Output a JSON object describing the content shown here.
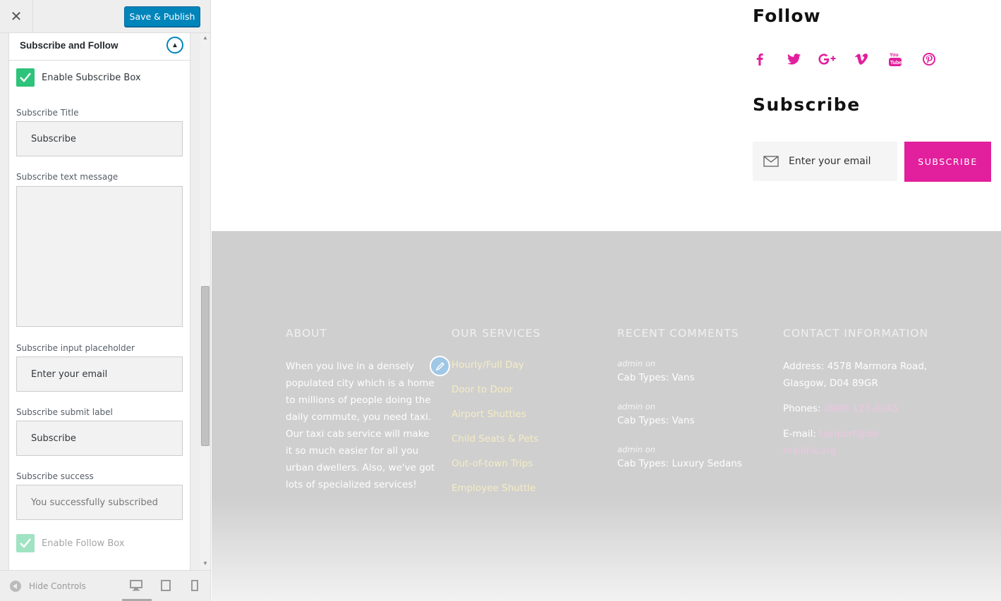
{
  "sidebar": {
    "close_label": "✕",
    "save_label": "Save & Publish",
    "section_title": "Subscribe and Follow",
    "enable_subscribe_label": "Enable Subscribe Box",
    "subscribe_title_label": "Subscribe Title",
    "subscribe_title_value": "Subscribe",
    "subscribe_text_label": "Subscribe text message",
    "subscribe_text_value": "",
    "placeholder_label": "Subscribe input placeholder",
    "placeholder_value": "Enter your email",
    "submit_label": "Subscribe submit label",
    "submit_value": "Subscribe",
    "success_label": "Subscribe success",
    "success_value": "You successfully subscribed",
    "enable_follow_label": "Enable Follow Box",
    "hide_controls_label": "Hide Controls",
    "checkbox_color": "#2ec37a",
    "accent_color": "#0085ba"
  },
  "preview": {
    "follow_title": "Follow",
    "social_icons": [
      "facebook-icon",
      "twitter-icon",
      "google-plus-icon",
      "vimeo-icon",
      "youtube-icon",
      "pinterest-icon"
    ],
    "subscribe_title": "Subscribe",
    "email_placeholder": "Enter your email",
    "subscribe_button": "SUBSCRIBE",
    "accent_color": "#e21f9c",
    "footer": {
      "about": {
        "title": "ABOUT",
        "text": "When you live in a densely populated city which is a home to millions of people doing the daily commute, you need taxi. Our taxi cab service will make it so much easier for all you urban dwellers. Also, we've got lots of specialized services!"
      },
      "services": {
        "title": "OUR SERVICES",
        "links": [
          "Hourly/Full Day",
          "Door to Door",
          "Airport Shuttles",
          "Child Seats & Pets",
          "Out-of-town Trips",
          "Employee Shuttle"
        ]
      },
      "comments": {
        "title": "RECENT COMMENTS",
        "items": [
          {
            "meta": "admin  on",
            "link": "Cab Types: Vans"
          },
          {
            "meta": "admin  on",
            "link": "Cab Types: Vans"
          },
          {
            "meta": "admin  on",
            "link": "Cab Types: Luxury Sedans"
          }
        ]
      },
      "contact": {
        "title": "CONTACT INFORMATION",
        "address": "Address: 4578 Marmora Road, Glasgow, D04 89GR",
        "phones_label": "Phones: ",
        "phones_value": "(800) 123-0045",
        "email_label": "E-mail: ",
        "email_value": "taxiport@de-mailink.org"
      }
    }
  }
}
